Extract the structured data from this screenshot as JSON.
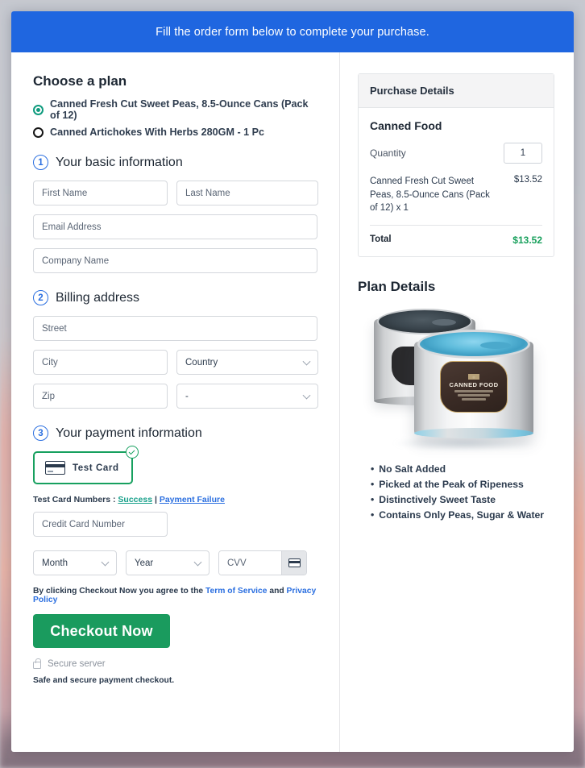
{
  "banner": {
    "text": "Fill the order form below to complete your purchase."
  },
  "plan": {
    "heading": "Choose a plan",
    "options": [
      {
        "label": "Canned Fresh Cut Sweet Peas, 8.5-Ounce Cans (Pack of 12)",
        "selected": true
      },
      {
        "label": "Canned Artichokes With Herbs 280GM - 1 Pc",
        "selected": false
      }
    ]
  },
  "step1": {
    "number": "1",
    "title": "Your basic information",
    "first_name_placeholder": "First Name",
    "last_name_placeholder": "Last Name",
    "email_placeholder": "Email Address",
    "company_placeholder": "Company Name"
  },
  "step2": {
    "number": "2",
    "title": "Billing address",
    "street_placeholder": "Street",
    "city_placeholder": "City",
    "country_value": "Country",
    "zip_placeholder": "Zip",
    "state_value": "-"
  },
  "step3": {
    "number": "3",
    "title": "Your payment information",
    "card_tile_label": "Test  Card",
    "test_numbers_prefix": "Test Card Numbers : ",
    "link_success": "Success",
    "separator": " | ",
    "link_failure": "Payment Failure",
    "card_number_placeholder": "Credit Card Number",
    "month_value": "Month",
    "year_value": "Year",
    "cvv_placeholder": "CVV"
  },
  "footer": {
    "agree_prefix": "By clicking Checkout Now you agree to the ",
    "terms_link": "Term of Service",
    "agree_middle": " and ",
    "privacy_link": "Privacy Policy",
    "checkout_button": "Checkout Now",
    "secure_server": "Secure server",
    "safe_note": "Safe and secure payment checkout."
  },
  "purchase": {
    "panel_title": "Purchase Details",
    "product_group": "Canned Food",
    "quantity_label": "Quantity",
    "quantity_value": "1",
    "line_item_name": "Canned Fresh Cut Sweet Peas, 8.5-Ounce Cans (Pack of 12) x 1",
    "line_item_price": "$13.52",
    "total_label": "Total",
    "total_value": "$13.52"
  },
  "plan_details": {
    "title": "Plan Details",
    "product_label": "CANNED FOOD",
    "bullets": [
      "No Salt Added",
      "Picked at the Peak of Ripeness",
      "Distinctively Sweet Taste",
      "Contains Only Peas, Sugar & Water"
    ]
  },
  "colors": {
    "banner_blue": "#1f66e0",
    "accent_green": "#1a9b5e",
    "radio_teal": "#0f9b7e",
    "link_blue": "#2b6fe0",
    "total_green": "#18a05c"
  }
}
